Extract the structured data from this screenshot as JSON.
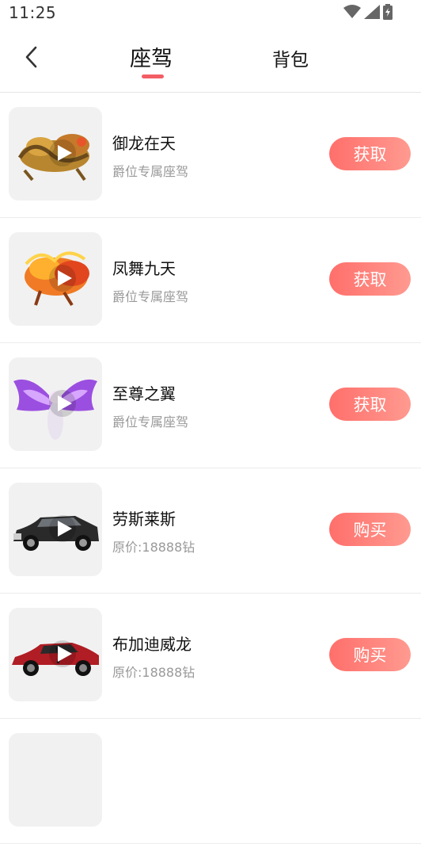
{
  "status_bar": {
    "time": "11:25"
  },
  "nav": {
    "tabs": [
      {
        "label": "座驾",
        "active": true
      },
      {
        "label": "背包",
        "active": false
      }
    ]
  },
  "items": [
    {
      "name": "御龙在天",
      "desc": "爵位专属座驾",
      "action": "获取",
      "thumb": "golden-dragon"
    },
    {
      "name": "凤舞九天",
      "desc": "爵位专属座驾",
      "action": "获取",
      "thumb": "fire-phoenix"
    },
    {
      "name": "至尊之翼",
      "desc": "爵位专属座驾",
      "action": "获取",
      "thumb": "purple-wings"
    },
    {
      "name": "劳斯莱斯",
      "desc": "原价:18888钻",
      "action": "购买",
      "thumb": "black-car"
    },
    {
      "name": "布加迪威龙",
      "desc": "原价:18888钻",
      "action": "购买",
      "thumb": "red-car"
    }
  ],
  "colors": {
    "accent": "#f35d65",
    "button_start": "#ff6f6b",
    "button_end": "#ff9a90"
  }
}
